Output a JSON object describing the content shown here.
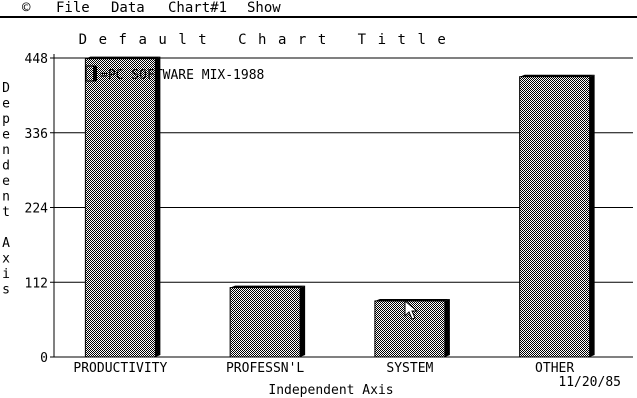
{
  "menu": {
    "apple": "©",
    "file": "File",
    "data": "Data",
    "chart": "Chart#1",
    "show": "Show"
  },
  "chart_data": {
    "type": "bar",
    "title": "Default Chart Title",
    "xlabel": "Independent Axis",
    "ylabel": "Dependent Axis",
    "categories": [
      "PRODUCTIVITY",
      "PROFESSN'L",
      "SYSTEM",
      "OTHER"
    ],
    "series": [
      {
        "name": "=PC SOFTWARE MIX-1988",
        "values": [
          447,
          104,
          84,
          420
        ]
      }
    ],
    "ylim": [
      0,
      448
    ],
    "yticks": [
      "0",
      "112",
      "224",
      "336",
      "448"
    ],
    "grid": true,
    "legend": "top-left",
    "date": "11/20/85"
  }
}
